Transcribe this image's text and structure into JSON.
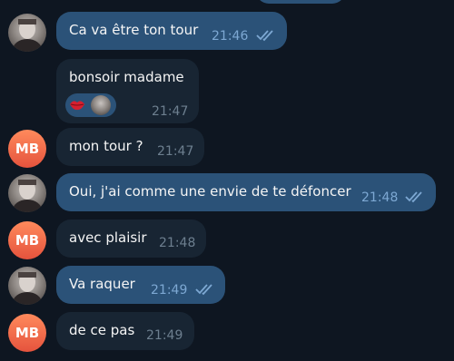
{
  "messages": [
    {
      "id": 1,
      "direction": "out",
      "text": "Ca va être ton tour",
      "time": "21:46",
      "status": "read"
    },
    {
      "id": 2,
      "direction": "in",
      "text": "bonsoir madame",
      "time": "21:47",
      "reaction": "kiss-mark"
    },
    {
      "id": 3,
      "direction": "in",
      "text": "mon tour ?",
      "time": "21:47"
    },
    {
      "id": 4,
      "direction": "out",
      "text": "Oui, j'ai comme une envie de te défoncer",
      "time": "21:48",
      "status": "read"
    },
    {
      "id": 5,
      "direction": "in",
      "text": "avec plaisir",
      "time": "21:48"
    },
    {
      "id": 6,
      "direction": "out",
      "text": "Va raquer",
      "time": "21:49",
      "status": "read"
    },
    {
      "id": 7,
      "direction": "in",
      "text": "de ce pas",
      "time": "21:49"
    }
  ],
  "contact": {
    "initials": "MB"
  },
  "colors": {
    "background": "#0e1621",
    "outgoing_bubble": "#2b5278",
    "incoming_bubble": "#182533",
    "read_check": "#7da8d3",
    "avatar_gradient": [
      "#ff8a5c",
      "#e5533d"
    ]
  },
  "icons": {
    "status": "double-check-icon",
    "reaction": "kiss-mark-icon"
  }
}
